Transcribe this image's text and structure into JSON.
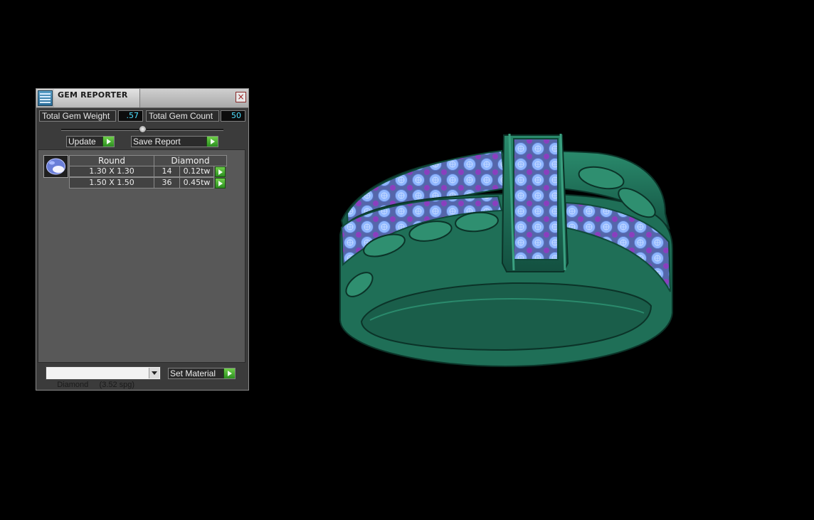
{
  "panel": {
    "title": "GEM REPORTER",
    "close_glyph": "×",
    "title_icon": "gem-reporter-icon",
    "total_weight_label": "Total Gem Weight",
    "total_weight_value": ".57",
    "total_count_label": "Total Gem Count",
    "total_count_value": "50",
    "update_label": "Update",
    "save_report_label": "Save Report",
    "table": {
      "shape": "Round",
      "material": "Diamond",
      "rows": [
        {
          "size": "1.30 X 1.30",
          "count": "14",
          "weight": "0.12tw"
        },
        {
          "size": "1.50 X 1.50",
          "count": "36",
          "weight": "0.45tw"
        }
      ]
    },
    "material_select": "Diamond     (3.52 spg)",
    "set_material_label": "Set Material"
  },
  "colors": {
    "value_text": "#4fe0ff",
    "metal": "#1e6e57",
    "gem_blue": "#78a8ff",
    "gem_purple": "#8a3fbf",
    "go_button": "#3aa82a"
  }
}
